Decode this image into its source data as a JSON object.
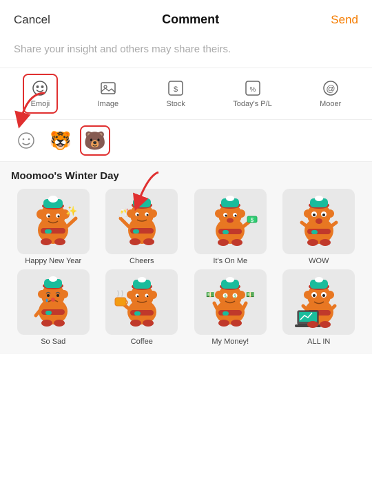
{
  "header": {
    "cancel_label": "Cancel",
    "title": "Comment",
    "send_label": "Send"
  },
  "placeholder": "Share your insight and others may share theirs.",
  "toolbar": {
    "items": [
      {
        "id": "emoji",
        "label": "Emoji",
        "active": true
      },
      {
        "id": "image",
        "label": "Image",
        "active": false
      },
      {
        "id": "stock",
        "label": "Stock",
        "active": false
      },
      {
        "id": "pnl",
        "label": "Today's P/L",
        "active": false
      },
      {
        "id": "mooer",
        "label": "Mooer",
        "active": false
      }
    ]
  },
  "emoji_subtoolbar": {
    "items": [
      {
        "id": "smiley",
        "type": "smiley",
        "active": false
      },
      {
        "id": "fire",
        "type": "fire",
        "active": false
      },
      {
        "id": "hat",
        "type": "hat",
        "active": true
      }
    ]
  },
  "sticker_section": {
    "title": "Moomoo's Winter Day",
    "stickers": [
      {
        "id": "happy-new-year",
        "label": "Happy New Year",
        "emoji": "🎉"
      },
      {
        "id": "cheers",
        "label": "Cheers",
        "emoji": "🥂"
      },
      {
        "id": "its-on-me",
        "label": "It's On Me",
        "emoji": "💰"
      },
      {
        "id": "wow",
        "label": "WOW",
        "emoji": "😱"
      },
      {
        "id": "so-sad",
        "label": "So Sad",
        "emoji": "😢"
      },
      {
        "id": "coffee",
        "label": "Coffee",
        "emoji": "☕"
      },
      {
        "id": "my-money",
        "label": "My Money!",
        "emoji": "💸"
      },
      {
        "id": "all-in",
        "label": "ALL IN",
        "emoji": "💻"
      }
    ]
  },
  "colors": {
    "accent": "#f57c00",
    "arrow_red": "#e03030",
    "active_border": "#e03030"
  }
}
